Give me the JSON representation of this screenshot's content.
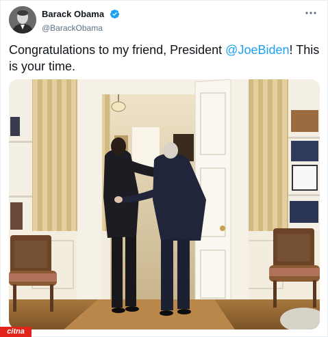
{
  "tweet": {
    "author_name": "Barack Obama",
    "author_handle": "@BarackObama",
    "text_before": "Congratulations to my friend, President ",
    "mention": "@JoeBiden",
    "text_after": "! This is your time."
  },
  "icons": {
    "verified": "verified-badge-icon",
    "more": "more-options-icon"
  },
  "colors": {
    "link": "#1da1f2",
    "verified": "#1da1f2",
    "handle": "#5b7083",
    "watermark": "#e2231a"
  },
  "media": {
    "description_kind": "photograph"
  },
  "watermark": {
    "text": "citna"
  }
}
